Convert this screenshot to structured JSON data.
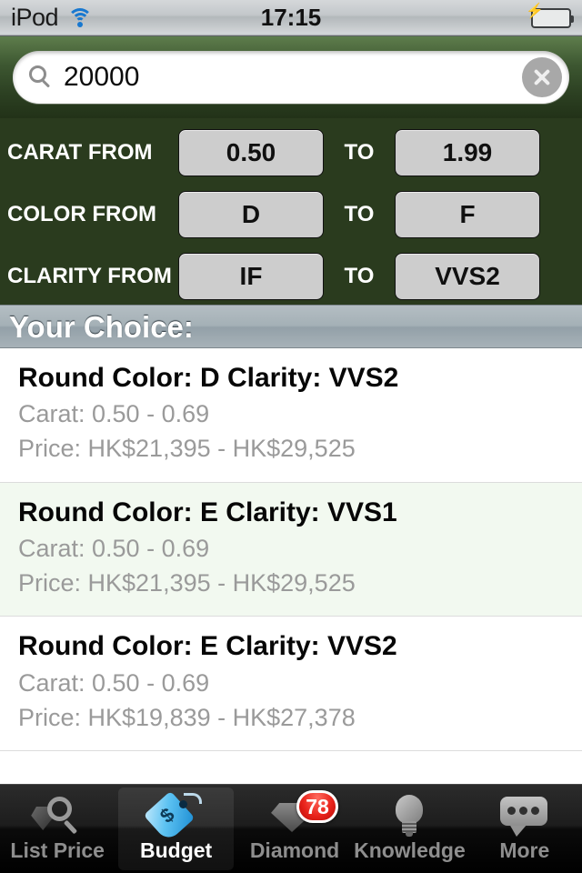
{
  "statusbar": {
    "carrier": "iPod",
    "wifi_icon": "wifi-icon",
    "time": "17:15",
    "battery_icon": "battery-charging-icon",
    "battery_bolt": "⚡"
  },
  "search": {
    "icon": "search-icon",
    "value": "20000",
    "placeholder": "Search",
    "clear_icon": "clear-icon"
  },
  "filters": {
    "to_label": "TO",
    "rows": [
      {
        "label": "CARAT FROM",
        "from": "0.50",
        "to": "1.99"
      },
      {
        "label": "COLOR FROM",
        "from": "D",
        "to": "F"
      },
      {
        "label": "CLARITY FROM",
        "from": "IF",
        "to": "VVS2"
      }
    ]
  },
  "section": {
    "title": "Your Choice:"
  },
  "results": [
    {
      "title": "Round  Color: D  Clarity: VVS2",
      "carat": "Carat: 0.50 - 0.69",
      "price": "Price: HK$21,395 - HK$29,525"
    },
    {
      "title": "Round  Color: E  Clarity: VVS1",
      "carat": "Carat: 0.50 - 0.69",
      "price": "Price: HK$21,395 - HK$29,525"
    },
    {
      "title": "Round  Color: E  Clarity: VVS2",
      "carat": "Carat: 0.50 - 0.69",
      "price": "Price: HK$19,839 - HK$27,378"
    }
  ],
  "tabbar": {
    "items": [
      {
        "label": "List Price",
        "icon": "magnifier-diamond-icon",
        "selected": false
      },
      {
        "label": "Budget",
        "icon": "price-tag-icon",
        "selected": true
      },
      {
        "label": "Diamond",
        "icon": "diamond-icon",
        "selected": false,
        "badge": "78"
      },
      {
        "label": "Knowledge",
        "icon": "lightbulb-icon",
        "selected": false
      },
      {
        "label": "More",
        "icon": "chat-bubble-icon",
        "selected": false
      }
    ]
  },
  "colors": {
    "panel_green": "#2a3b1e",
    "search_green_top": "#5e7d4c",
    "section_header": "#a4b0b6",
    "alt_row": "#f2f9f0",
    "badge_red": "#e8221a",
    "tag_blue": "#5cc2f2"
  }
}
